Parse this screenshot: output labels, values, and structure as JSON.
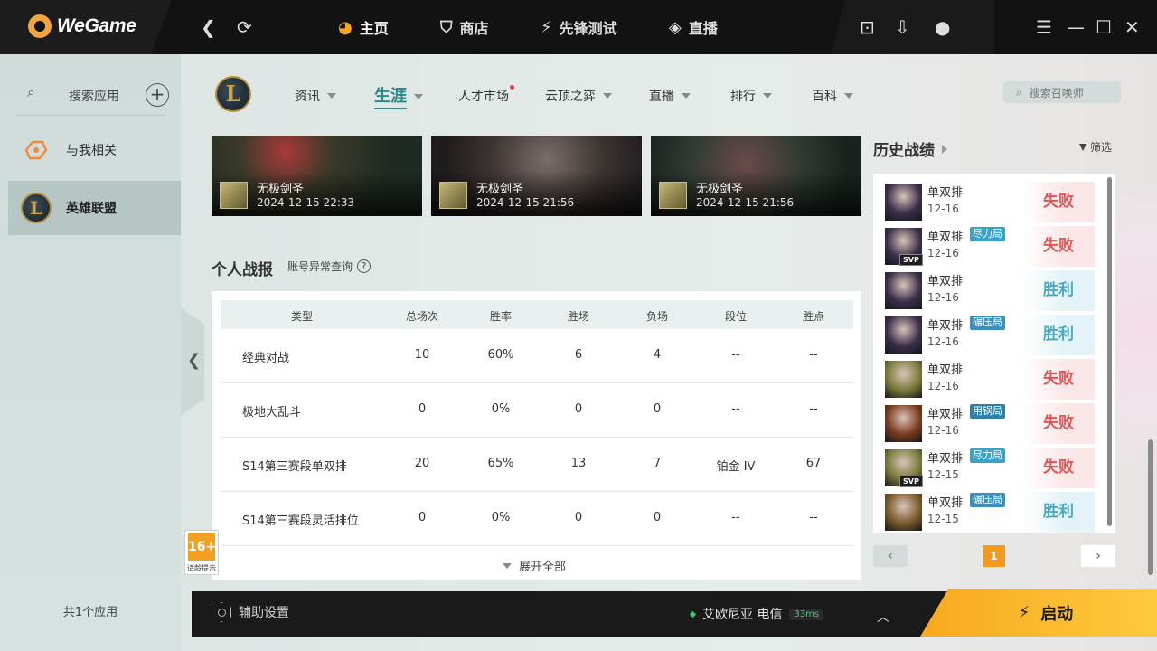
{
  "app": {
    "brand": "WeGame"
  },
  "topnav": [
    {
      "label": "主页",
      "icon": "home-icon"
    },
    {
      "label": "商店",
      "icon": "store-bag-icon"
    },
    {
      "label": "先锋测试",
      "icon": "vanguard-test-icon"
    },
    {
      "label": "直播",
      "icon": "live-icon"
    }
  ],
  "sidebar": {
    "search_label": "搜索应用",
    "items": [
      {
        "label": "与我相关",
        "icon": "related-icon"
      },
      {
        "label": "英雄联盟",
        "icon": "league-of-legends-icon"
      }
    ],
    "app_count": "共1个应用"
  },
  "game": {
    "logo_letter": "L",
    "tabs": [
      {
        "label": "资讯",
        "caret": true,
        "dot": false
      },
      {
        "label": "生涯",
        "caret": true,
        "dot": false
      },
      {
        "label": "人才市场",
        "caret": false,
        "dot": true
      },
      {
        "label": "云顶之弈",
        "caret": true,
        "dot": false
      },
      {
        "label": "直播",
        "caret": true,
        "dot": false
      },
      {
        "label": "排行",
        "caret": true,
        "dot": false
      },
      {
        "label": "百科",
        "caret": true,
        "dot": false
      }
    ],
    "active_tab": "生涯",
    "search_placeholder": "搜索召唤师"
  },
  "highlights": [
    {
      "name": "无极剑圣",
      "time": "2024-12-15 22:33"
    },
    {
      "name": "无极剑圣",
      "time": "2024-12-15 21:56"
    },
    {
      "name": "无极剑圣",
      "time": "2024-12-15 21:56"
    }
  ],
  "personal": {
    "title": "个人战报",
    "account_link": "账号异常查询",
    "help_symbol": "?",
    "columns": [
      "类型",
      "总场次",
      "胜率",
      "胜场",
      "负场",
      "段位",
      "胜点"
    ],
    "rows": [
      [
        "经典对战",
        "10",
        "60%",
        "6",
        "4",
        "--",
        "--"
      ],
      [
        "极地大乱斗",
        "0",
        "0%",
        "0",
        "0",
        "--",
        "--"
      ],
      [
        "S14第三赛段单双排",
        "20",
        "65%",
        "13",
        "7",
        "铂金 IV",
        "67"
      ],
      [
        "S14第三赛段灵活排位",
        "0",
        "0%",
        "0",
        "0",
        "--",
        "--"
      ]
    ],
    "expand_label": "展开全部"
  },
  "age_badge": {
    "rating": "16+",
    "tip": "适龄提示"
  },
  "history": {
    "title": "历史战绩",
    "filter_label": "筛选",
    "matches": [
      {
        "mode": "单双排",
        "tag": "",
        "date": "12-16",
        "result": "失败",
        "win": false,
        "svp": false,
        "champ_color": "#3b2f4a"
      },
      {
        "mode": "单双排",
        "tag": "尽力局",
        "date": "12-16",
        "result": "失败",
        "win": false,
        "svp": true,
        "champ_color": "#3b2f4a"
      },
      {
        "mode": "单双排",
        "tag": "",
        "date": "12-16",
        "result": "胜利",
        "win": true,
        "svp": false,
        "champ_color": "#3b2f4a"
      },
      {
        "mode": "单双排",
        "tag": "碾压局",
        "date": "12-16",
        "result": "胜利",
        "win": true,
        "svp": false,
        "champ_color": "#3b2f4a"
      },
      {
        "mode": "单双排",
        "tag": "",
        "date": "12-16",
        "result": "失败",
        "win": false,
        "svp": false,
        "champ_color": "#7a7a3a"
      },
      {
        "mode": "单双排",
        "tag": "用锅局",
        "date": "12-16",
        "result": "失败",
        "win": false,
        "svp": false,
        "champ_color": "#7a3a1e"
      },
      {
        "mode": "单双排",
        "tag": "尽力局",
        "date": "12-15",
        "result": "失败",
        "win": false,
        "svp": true,
        "champ_color": "#7a7a3a"
      },
      {
        "mode": "单双排",
        "tag": "碾压局",
        "date": "12-15",
        "result": "胜利",
        "win": true,
        "svp": false,
        "champ_color": "#7a5a2a"
      }
    ],
    "svp_label": "SVP",
    "tag_colors": {
      "尽力局": "#37a3c9",
      "碾压局": "#3a8fc0",
      "用锅局": "#2e7fa8"
    },
    "page": "1",
    "prev": "‹",
    "next": "›"
  },
  "bottom": {
    "assist_label": "辅助设置",
    "server": "艾欧尼亚 电信",
    "ping": "33ms",
    "launch_label": "启动"
  }
}
